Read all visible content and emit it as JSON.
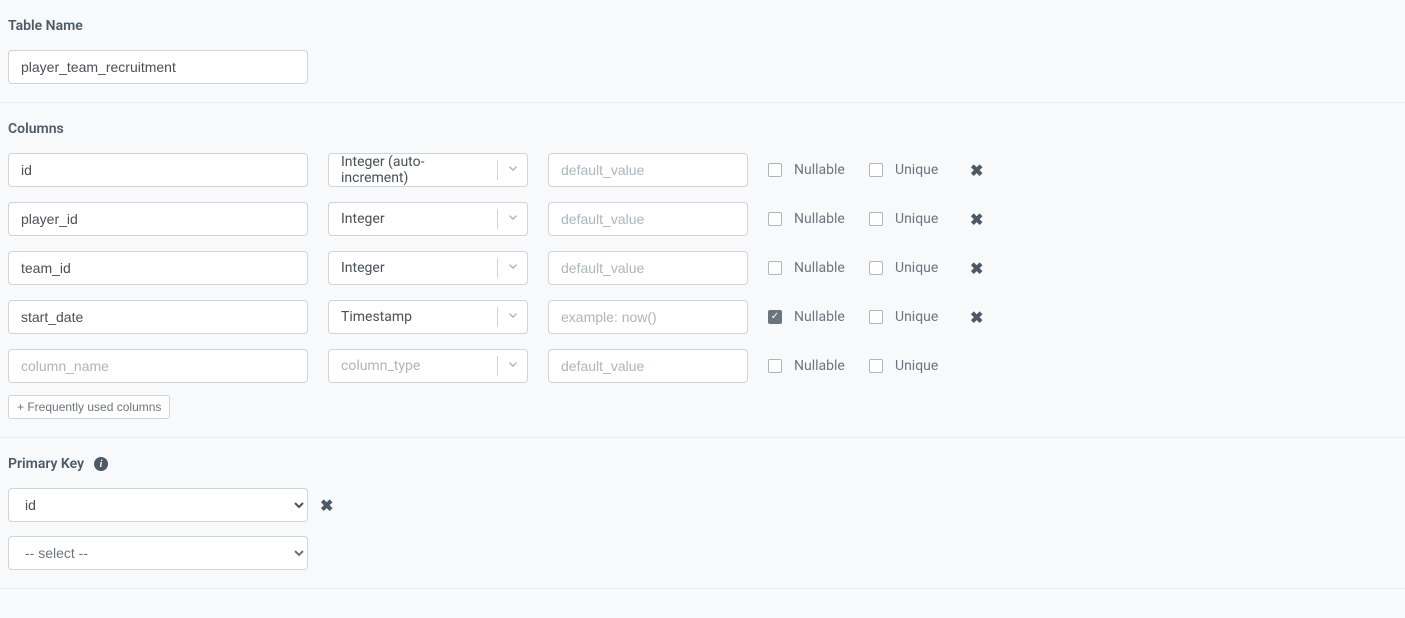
{
  "tableNameSection": {
    "title": "Table Name",
    "value": "player_team_recruitment"
  },
  "columnsSection": {
    "title": "Columns",
    "defaultPlaceholderName": "column_name",
    "defaultPlaceholderType": "column_type",
    "defaultPlaceholderValue": "default_value",
    "nullableLabel": "Nullable",
    "uniqueLabel": "Unique",
    "freqBtnLabel": "+ Frequently used columns",
    "rows": [
      {
        "name": "id",
        "type": "Integer (auto-increment)",
        "defaultVal": "",
        "defaultPh": "default_value",
        "nullable": false,
        "unique": false,
        "removable": true
      },
      {
        "name": "player_id",
        "type": "Integer",
        "defaultVal": "",
        "defaultPh": "default_value",
        "nullable": false,
        "unique": false,
        "removable": true
      },
      {
        "name": "team_id",
        "type": "Integer",
        "defaultVal": "",
        "defaultPh": "default_value",
        "nullable": false,
        "unique": false,
        "removable": true
      },
      {
        "name": "start_date",
        "type": "Timestamp",
        "defaultVal": "",
        "defaultPh": "example: now()",
        "nullable": true,
        "unique": false,
        "removable": true
      },
      {
        "name": "",
        "type": "",
        "defaultVal": "",
        "defaultPh": "default_value",
        "nullable": false,
        "unique": false,
        "removable": false
      }
    ]
  },
  "primaryKeySection": {
    "title": "Primary Key",
    "rows": [
      {
        "value": "id",
        "removable": true
      },
      {
        "value": "-- select --",
        "removable": false,
        "placeholder": true
      }
    ]
  }
}
